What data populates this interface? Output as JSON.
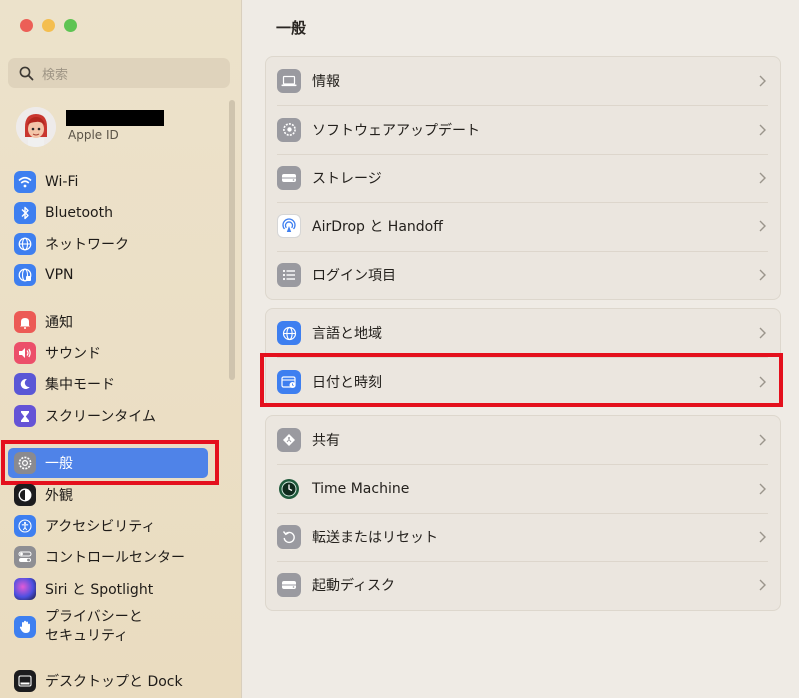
{
  "sidebar": {
    "search_placeholder": "検索",
    "profile_label": "Apple ID",
    "items": [
      {
        "label": "Wi-Fi"
      },
      {
        "label": "Bluetooth"
      },
      {
        "label": "ネットワーク"
      },
      {
        "label": "VPN"
      },
      {
        "label": "通知"
      },
      {
        "label": "サウンド"
      },
      {
        "label": "集中モード"
      },
      {
        "label": "スクリーンタイム"
      },
      {
        "label": "一般"
      },
      {
        "label": "外観"
      },
      {
        "label": "アクセシビリティ"
      },
      {
        "label": "コントロールセンター"
      },
      {
        "label": "Siri と Spotlight"
      },
      {
        "label": "プライバシーと\nセキュリティ"
      },
      {
        "label": "デスクトップと Dock"
      }
    ]
  },
  "main": {
    "title": "一般",
    "group1": [
      {
        "label": "情報"
      },
      {
        "label": "ソフトウェアアップデート"
      },
      {
        "label": "ストレージ"
      },
      {
        "label": "AirDrop と Handoff"
      },
      {
        "label": "ログイン項目"
      }
    ],
    "group2": [
      {
        "label": "言語と地域"
      },
      {
        "label": "日付と時刻"
      }
    ],
    "group3": [
      {
        "label": "共有"
      },
      {
        "label": "Time Machine"
      },
      {
        "label": "転送またはリセット"
      },
      {
        "label": "起動ディスク"
      }
    ]
  },
  "colors": {
    "selection": "#4f83e8",
    "highlight_box": "#e4101d",
    "sidebar_bg": "#ece2cb"
  }
}
